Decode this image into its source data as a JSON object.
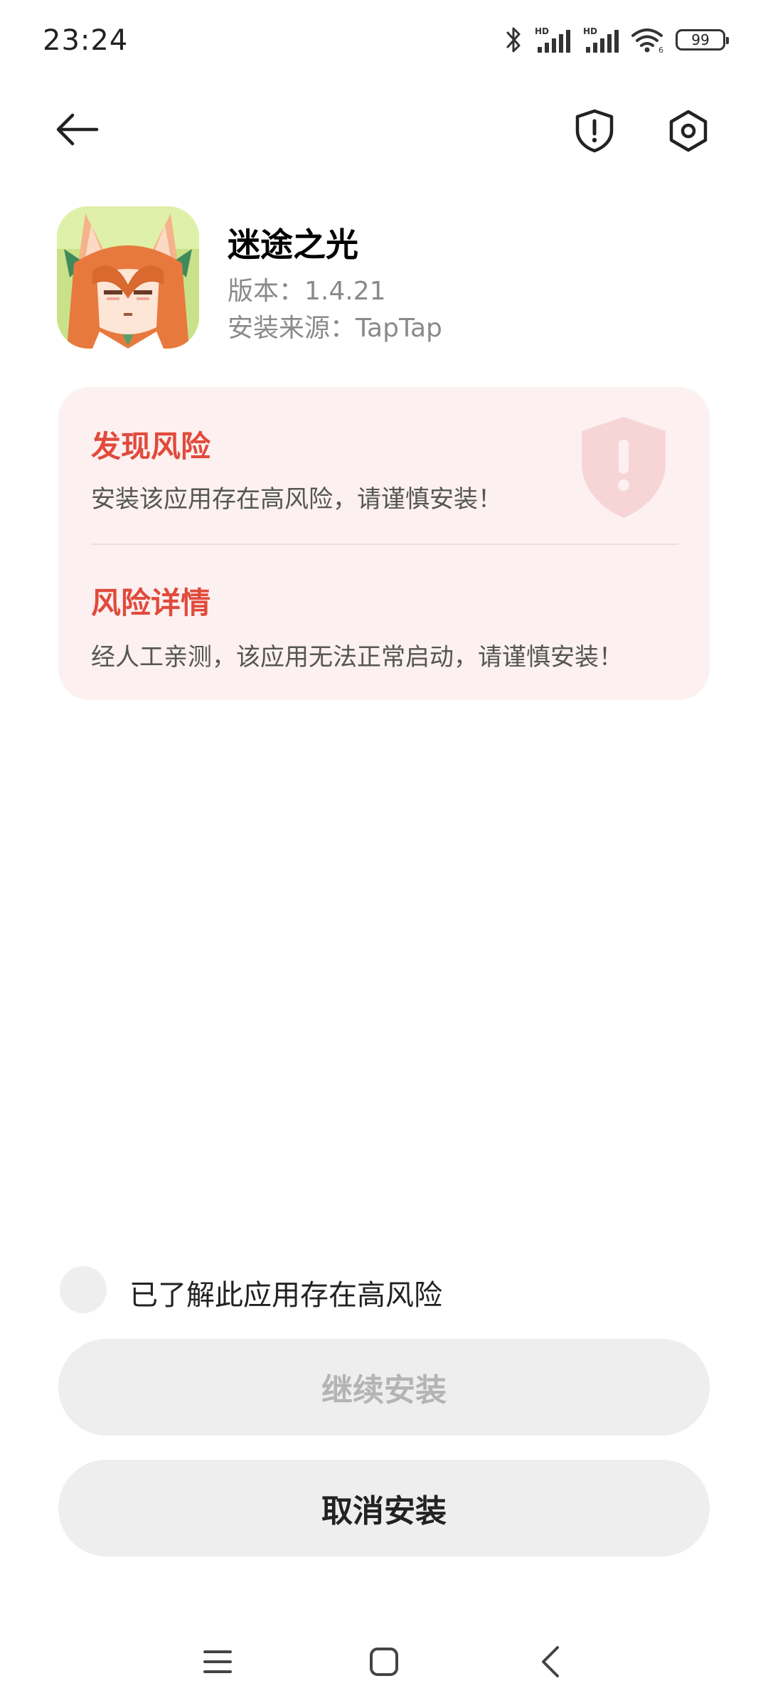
{
  "status_bar": {
    "time": "23:24",
    "battery_level": "99",
    "icons": [
      "bluetooth-icon",
      "signal-hd-icon",
      "signal-hd-icon",
      "wifi-icon",
      "battery-icon"
    ],
    "wifi_label": "6",
    "hd_label": "HD"
  },
  "top_nav": {
    "back_icon": "arrow-left-icon",
    "shield_icon": "shield-alert-icon",
    "settings_icon": "settings-hexagon-icon"
  },
  "app": {
    "name": "迷途之光",
    "version": "版本：1.4.21",
    "source": "安装来源：TapTap"
  },
  "risk_card": {
    "found_title": "发现风险",
    "found_desc": "安装该应用存在高风险，请谨慎安装！",
    "detail_title": "风险详情",
    "detail_desc": "经人工亲测，该应用无法正常启动，请谨慎安装！",
    "accent_color": "#e04b3c",
    "background_color": "#fdf0f0"
  },
  "confirm": {
    "label": "已了解此应用存在高风险",
    "checked": false
  },
  "buttons": {
    "continue_label": "继续安装",
    "continue_enabled": false,
    "cancel_label": "取消安装"
  },
  "system_nav": {
    "menu_icon": "menu-icon",
    "home_icon": "home-square-icon",
    "back_icon": "back-chevron-icon"
  }
}
